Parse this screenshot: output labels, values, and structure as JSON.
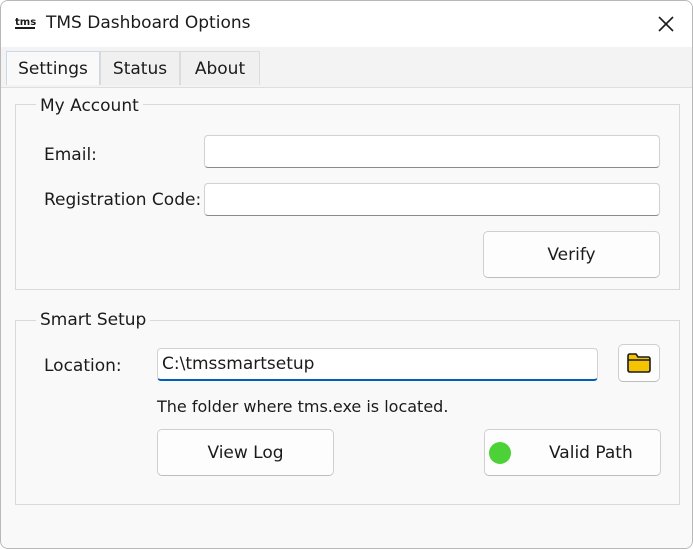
{
  "window": {
    "title": "TMS Dashboard Options",
    "icon_text": "tms"
  },
  "tabs": [
    {
      "label": "Settings",
      "active": true
    },
    {
      "label": "Status",
      "active": false
    },
    {
      "label": "About",
      "active": false
    }
  ],
  "account": {
    "group_title": "My Account",
    "email_label": "Email:",
    "email_value": "",
    "code_label": "Registration Code:",
    "code_value": "",
    "verify_label": "Verify"
  },
  "smart_setup": {
    "group_title": "Smart Setup",
    "location_label": "Location:",
    "location_value": "C:\\tmssmartsetup",
    "hint": "The folder where tms.exe is located.",
    "view_log_label": "View Log",
    "valid_path_label": "Valid Path",
    "status_color": "#4cd137",
    "folder_icon_color": "#f5c400"
  }
}
